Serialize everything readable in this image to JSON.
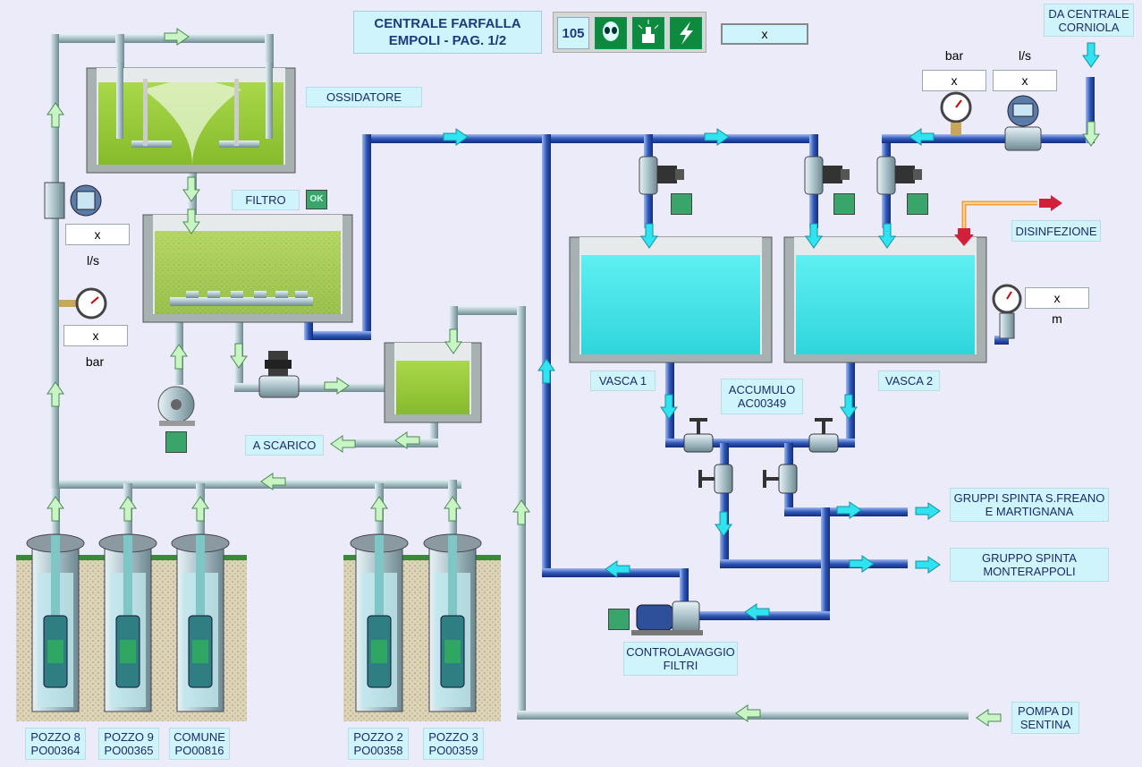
{
  "header": {
    "title": "CENTRALE FARFALLA EMPOLI - PAG. 1/2",
    "page_number": "105",
    "top_value": "x"
  },
  "toolbar": {
    "icons": [
      "alien-icon",
      "alarm-lamp-icon",
      "lightning-icon"
    ]
  },
  "labels": {
    "ossidatore": "OSSIDATORE",
    "filtro": "FILTRO",
    "filtro_status": "OK",
    "a_scarico": "A SCARICO",
    "da_centrale": "DA CENTRALE CORNIOLA",
    "disinfezione": "DISINFEZIONE",
    "vasca1": "VASCA 1",
    "vasca2": "VASCA 2",
    "accumulo": "ACCUMULO AC00349",
    "gruppi_spinta": "GRUPPI  SPINTA S.FREANO E MARTIGNANA",
    "gruppo_spinta": "GRUPPO SPINTA MONTERAPPOLI",
    "controlavaggio": "CONTROLAVAGGIO FILTRI",
    "pompa_sentina": "POMPA DI SENTINA"
  },
  "wells": [
    {
      "name": "POZZO 8",
      "code": "PO00364"
    },
    {
      "name": "POZZO 9",
      "code": "PO00365"
    },
    {
      "name": "COMUNE",
      "code": "PO00816"
    },
    {
      "name": "POZZO 2",
      "code": "PO00358"
    },
    {
      "name": "POZZO 3",
      "code": "PO00359"
    }
  ],
  "measurements": {
    "inlet_flow": {
      "value": "x",
      "unit": "l/s"
    },
    "inlet_pressure": {
      "value": "x",
      "unit": "bar"
    },
    "corniola_pressure": {
      "value": "x",
      "unit": "bar"
    },
    "corniola_flow": {
      "value": "x",
      "unit": "l/s"
    },
    "vasca_level": {
      "value": "x",
      "unit": "m"
    }
  },
  "colors": {
    "background": "#ebebf9",
    "label_bg": "#cff4fb",
    "pipe_blue": "#2f57b8",
    "pipe_grey": "#a9c0c8",
    "sludge_green": "#9ccd38",
    "tank_water": "#3fe1e5",
    "arrow_cyan": "#2fe3f0",
    "arrow_pale": "#c9f5c4",
    "status_green": "#3aa56a",
    "disinfection_red": "#d0203a"
  }
}
